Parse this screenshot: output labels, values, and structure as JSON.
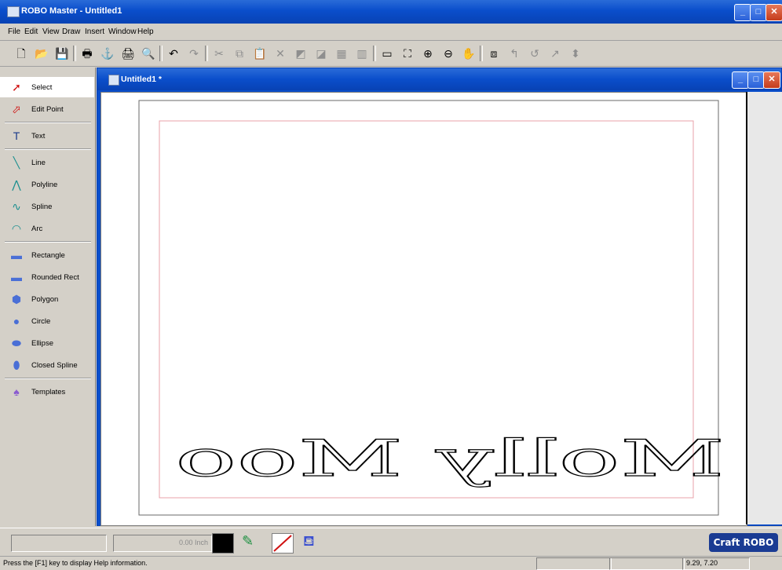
{
  "app": {
    "title": "ROBO Master - Untitled1"
  },
  "menu": [
    "File",
    "Edit",
    "View",
    "Draw",
    "Insert",
    "Window",
    "Help"
  ],
  "toolbar": {
    "items": [
      {
        "name": "new-icon",
        "glyph": "🗋",
        "disabled": false
      },
      {
        "name": "open-icon",
        "glyph": "📂",
        "disabled": false
      },
      {
        "name": "save-icon",
        "glyph": "💾",
        "disabled": false
      },
      {
        "name": "print-icon",
        "glyph": "🖶",
        "disabled": false
      },
      {
        "name": "cutter-icon",
        "glyph": "⚓",
        "disabled": false
      },
      {
        "name": "print-setup-icon",
        "glyph": "🖨",
        "disabled": false
      },
      {
        "name": "print-preview-icon",
        "glyph": "🔍",
        "disabled": false
      },
      {
        "name": "undo-icon",
        "glyph": "↶",
        "disabled": false
      },
      {
        "name": "redo-icon",
        "glyph": "↷",
        "disabled": true
      },
      {
        "name": "cut-icon",
        "glyph": "✂",
        "disabled": true
      },
      {
        "name": "copy-icon",
        "glyph": "⧉",
        "disabled": true
      },
      {
        "name": "paste-icon",
        "glyph": "📋",
        "disabled": true
      },
      {
        "name": "delete-icon",
        "glyph": "✕",
        "disabled": true
      },
      {
        "name": "bring-forward-icon",
        "glyph": "◩",
        "disabled": true
      },
      {
        "name": "send-backward-icon",
        "glyph": "◪",
        "disabled": true
      },
      {
        "name": "align-icon",
        "glyph": "▦",
        "disabled": true
      },
      {
        "name": "distribute-icon",
        "glyph": "▥",
        "disabled": true
      },
      {
        "name": "rectangle-frame-icon",
        "glyph": "▭",
        "disabled": false
      },
      {
        "name": "zoom-fit-icon",
        "glyph": "⛶",
        "disabled": false
      },
      {
        "name": "zoom-in-icon",
        "glyph": "⊕",
        "disabled": false
      },
      {
        "name": "zoom-out-icon",
        "glyph": "⊖",
        "disabled": false
      },
      {
        "name": "pan-icon",
        "glyph": "✋",
        "disabled": false
      },
      {
        "name": "group-icon",
        "glyph": "⧈",
        "disabled": false
      },
      {
        "name": "rotate-left-icon",
        "glyph": "↰",
        "disabled": true
      },
      {
        "name": "rotate-right-icon",
        "glyph": "↺",
        "disabled": true
      },
      {
        "name": "flip-icon",
        "glyph": "↗",
        "disabled": true
      },
      {
        "name": "arrange-icon",
        "glyph": "⬍",
        "disabled": true
      }
    ]
  },
  "sidebar": {
    "items": [
      {
        "label": "Select",
        "icon": "select-arrow-icon",
        "glyph": "➚",
        "color": "#d01010",
        "selected": true
      },
      {
        "label": "Edit Point",
        "icon": "edit-point-icon",
        "glyph": "⬀",
        "color": "#d01010"
      },
      {
        "label": "Text",
        "icon": "text-icon",
        "glyph": "T",
        "color": "#1a3a8a"
      },
      {
        "label": "Line",
        "icon": "line-icon",
        "glyph": "╲",
        "color": "#1b8f8f"
      },
      {
        "label": "Polyline",
        "icon": "polyline-icon",
        "glyph": "⋀",
        "color": "#1b8f8f"
      },
      {
        "label": "Spline",
        "icon": "spline-icon",
        "glyph": "∿",
        "color": "#1b8f8f"
      },
      {
        "label": "Arc",
        "icon": "arc-icon",
        "glyph": "◠",
        "color": "#1b8f8f"
      },
      {
        "label": "Rectangle",
        "icon": "rectangle-icon",
        "glyph": "▬",
        "color": "#4a6fd6"
      },
      {
        "label": "Rounded Rect",
        "icon": "rounded-rect-icon",
        "glyph": "▬",
        "color": "#4a6fd6"
      },
      {
        "label": "Polygon",
        "icon": "polygon-icon",
        "glyph": "⬢",
        "color": "#4a6fd6"
      },
      {
        "label": "Circle",
        "icon": "circle-icon",
        "glyph": "●",
        "color": "#4a6fd6"
      },
      {
        "label": "Ellipse",
        "icon": "ellipse-icon",
        "glyph": "⬬",
        "color": "#4a6fd6"
      },
      {
        "label": "Closed Spline",
        "icon": "closed-spline-icon",
        "glyph": "⬮",
        "color": "#4a6fd6"
      },
      {
        "label": "Templates",
        "icon": "templates-icon",
        "glyph": "♠",
        "color": "#8a5bd0"
      }
    ]
  },
  "document": {
    "title": "Untitled1 *",
    "text_object": "Molly Moo"
  },
  "bottom": {
    "line_width": "0.00 Inch",
    "fill_color": "#000000"
  },
  "status": {
    "help_text": "Press the [F1] key to display Help information.",
    "coords": "9.29, 7.20"
  },
  "brand": {
    "logo": "Craft ROBO"
  },
  "colors": {
    "title_bar": "#0a4ecb",
    "margin_line": "#e8a0a8"
  }
}
